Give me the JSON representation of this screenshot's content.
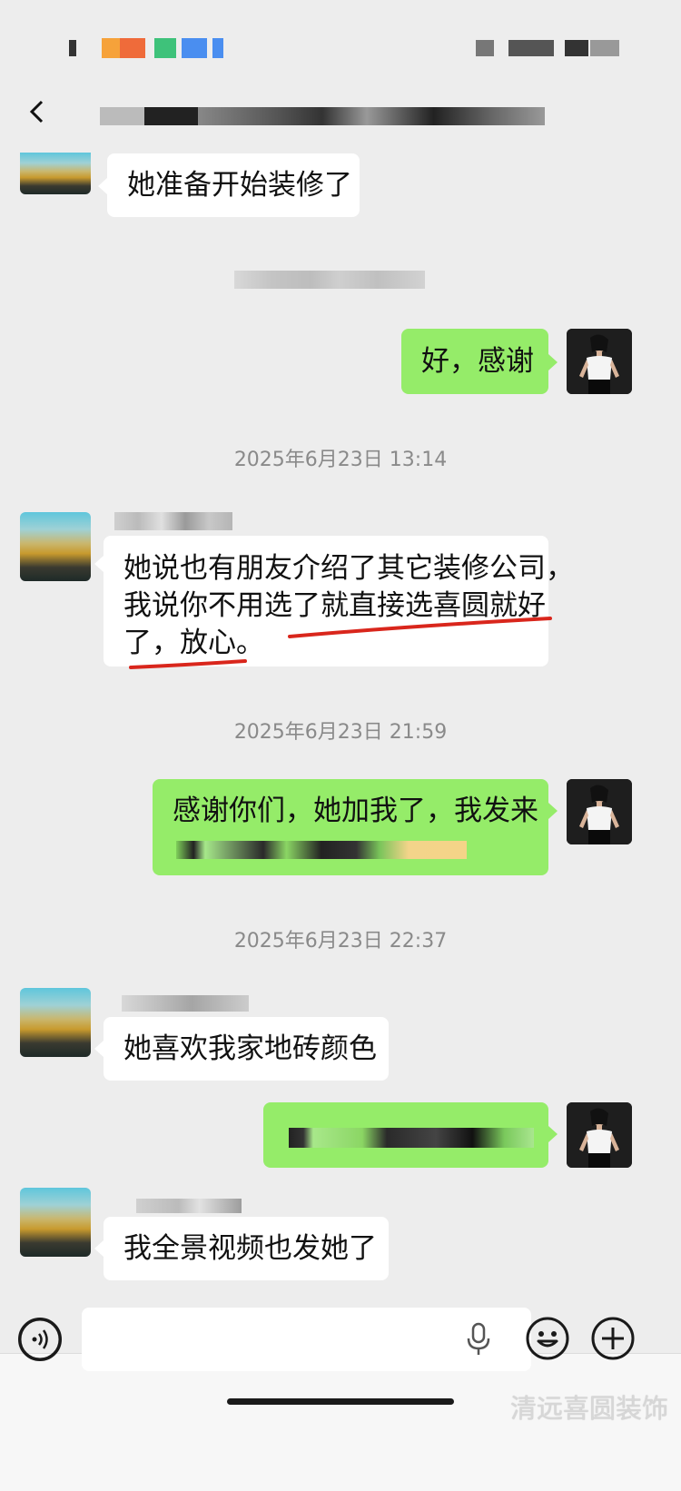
{
  "header": {
    "back_icon": "chevron-left-icon"
  },
  "messages": [
    {
      "side": "left",
      "text": "她准备开始装修了"
    },
    {
      "side": "right",
      "text": "好，感谢"
    },
    {
      "side": "left",
      "lines": [
        "她说也有朋友介绍了其它装修公司，",
        "我说你不用选了就直接选喜圆就好",
        "了，放心。"
      ]
    },
    {
      "side": "right",
      "text": "感谢你们，她加我了，我发来"
    },
    {
      "side": "left",
      "text": "她喜欢我家地砖颜色"
    },
    {
      "side": "left",
      "text": "我全景视频也发她了"
    }
  ],
  "timestamps": [
    "2025年6月23日 13:14",
    "2025年6月23日 21:59",
    "2025年6月23日 22:37"
  ],
  "input_bar": {
    "voice_icon": "voice-icon",
    "mic_icon": "mic-icon",
    "emoji_icon": "emoji-icon",
    "add_icon": "plus-icon"
  },
  "watermark": "清远喜圆装饰",
  "colors": {
    "background": "#ededed",
    "sent_bubble": "#95ec69",
    "received_bubble": "#ffffff",
    "underline": "#d9261c"
  }
}
